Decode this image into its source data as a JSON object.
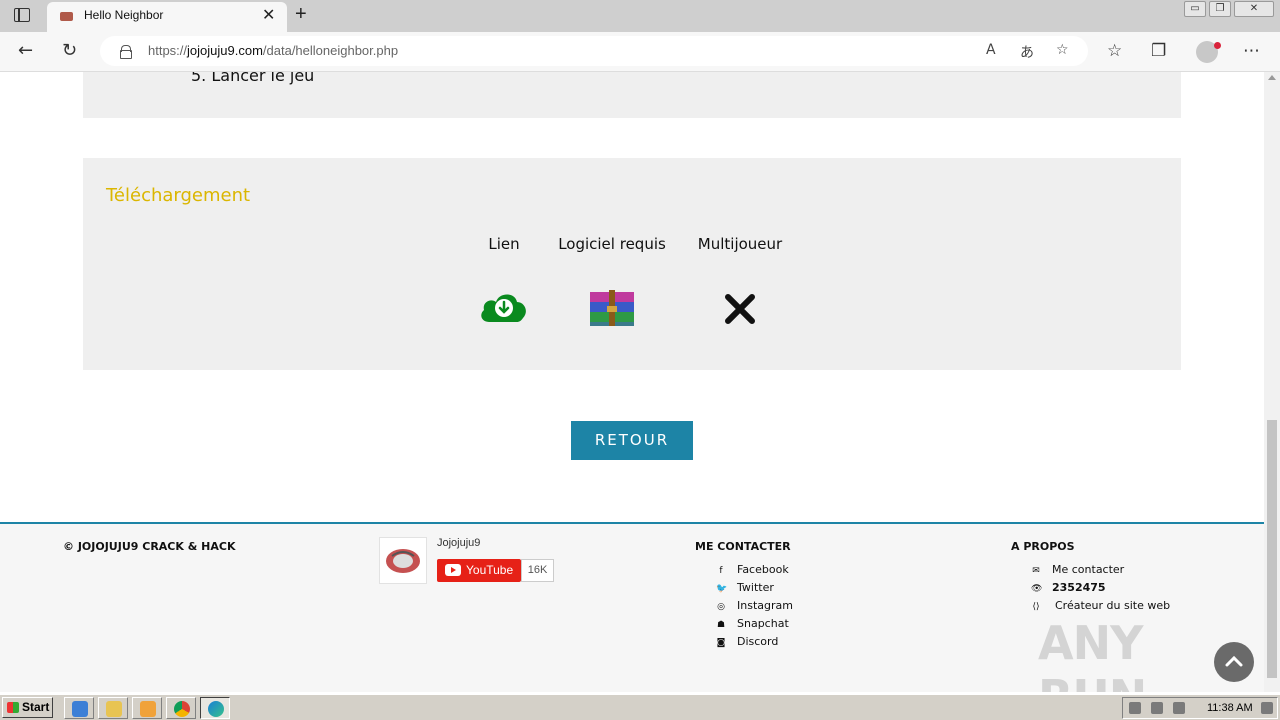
{
  "browser": {
    "tab_title": "Hello Neighbor",
    "tab_close": "✕",
    "new_tab": "+",
    "url_prefix": "https://",
    "url_domain": "jojojuju9.com",
    "url_path": "/data/helloneighbor.php",
    "window_controls": [
      "▭",
      "❐",
      "✕"
    ],
    "read_aloud_icon": "A",
    "translate_icon": "あ",
    "icons": [
      "back-arrow-icon",
      "refresh-icon",
      "lock-icon",
      "read-aloud-icon",
      "translate-icon",
      "add-favorite-icon",
      "favorites-icon",
      "collections-icon",
      "profile-avatar",
      "more-icon"
    ]
  },
  "content": {
    "step5": "5. Lancer le jeu",
    "download_title": "Téléchargement",
    "columns": [
      "Lien",
      "Logiciel requis",
      "Multijoueur"
    ],
    "retour_label": "RETOUR"
  },
  "footer": {
    "copyright": "© JOJOJUJU9 CRACK & HACK",
    "youtube": {
      "channel_name": "Jojojuju9",
      "button_label": "YouTube",
      "subscriber_count": "16K"
    },
    "contact": {
      "heading": "ME CONTACTER",
      "items": [
        {
          "label": "Facebook",
          "icon": "facebook-icon"
        },
        {
          "label": "Twitter",
          "icon": "twitter-icon"
        },
        {
          "label": "Instagram",
          "icon": "instagram-icon"
        },
        {
          "label": "Snapchat",
          "icon": "snapchat-icon"
        },
        {
          "label": "Discord",
          "icon": "discord-icon"
        }
      ]
    },
    "about": {
      "heading": "A PROPOS",
      "items": [
        {
          "label": "Me contacter",
          "icon": "envelope-icon"
        },
        {
          "label": "2352475",
          "icon": "eye-icon"
        },
        {
          "label": "Créateur du site web",
          "icon": "code-icon"
        }
      ]
    }
  },
  "overlay": {
    "watermark": "ANY RUN"
  },
  "taskbar": {
    "start_label": "Start",
    "clock": "11:38 AM"
  },
  "colors": {
    "accent_gold": "#dbb600",
    "button_teal": "#1d84a6",
    "download_green": "#0a8a1f",
    "youtube_red": "#e62117"
  }
}
